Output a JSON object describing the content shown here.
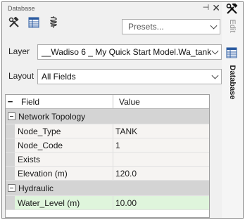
{
  "panel": {
    "title": "Database",
    "pin_glyph": "⊣",
    "close_glyph": "✕"
  },
  "toolbar": {
    "icons": [
      "tools-icon",
      "table-icon",
      "coil-icon"
    ]
  },
  "presets": {
    "label": "Presets..."
  },
  "layer": {
    "label": "Layer",
    "value": "__Wadiso 6 _ My Quick Start Model.Wa_tank"
  },
  "layout": {
    "label": "Layout",
    "value": "All Fields"
  },
  "grid": {
    "header": {
      "minus": "−",
      "field": "Field",
      "value": "Value"
    },
    "categories": [
      {
        "name": "Network Topology",
        "rows": [
          {
            "field": "Node_Type",
            "value": "TANK"
          },
          {
            "field": "Node_Code",
            "value": "1"
          },
          {
            "field": "Exists",
            "value": ""
          },
          {
            "field": "Elevation (m)",
            "value": "120.0"
          }
        ]
      },
      {
        "name": "Hydraulic",
        "rows": [
          {
            "field": "Water_Level (m)",
            "value": "10.00"
          }
        ]
      }
    ]
  },
  "side_tabs": {
    "edit": "Edit",
    "database": "Database"
  },
  "colors": {
    "selected_row": "#dff5dc",
    "category_bg": "#d4d4d4"
  }
}
